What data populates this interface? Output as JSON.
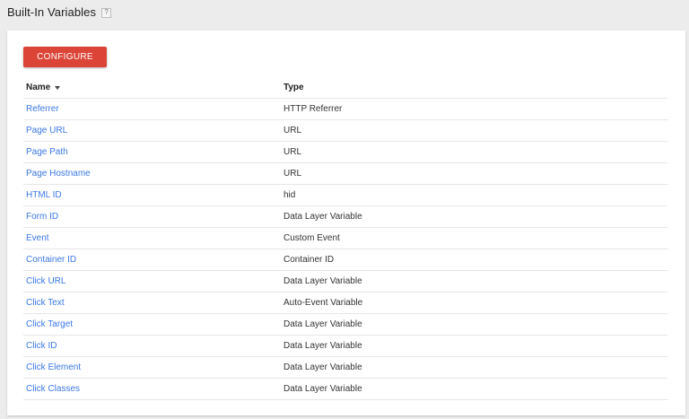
{
  "page": {
    "title": "Built-In Variables",
    "help_glyph": "?"
  },
  "toolbar": {
    "configure_label": "CONFIGURE"
  },
  "table": {
    "columns": {
      "name": "Name",
      "type": "Type"
    },
    "sort": {
      "column": "name",
      "direction": "descending-arrow"
    },
    "rows": [
      {
        "name": "Referrer",
        "type": "HTTP Referrer"
      },
      {
        "name": "Page URL",
        "type": "URL"
      },
      {
        "name": "Page Path",
        "type": "URL"
      },
      {
        "name": "Page Hostname",
        "type": "URL"
      },
      {
        "name": "HTML ID",
        "type": "hid"
      },
      {
        "name": "Form ID",
        "type": "Data Layer Variable"
      },
      {
        "name": "Event",
        "type": "Custom Event"
      },
      {
        "name": "Container ID",
        "type": "Container ID"
      },
      {
        "name": "Click URL",
        "type": "Data Layer Variable"
      },
      {
        "name": "Click Text",
        "type": "Auto-Event Variable"
      },
      {
        "name": "Click Target",
        "type": "Data Layer Variable"
      },
      {
        "name": "Click ID",
        "type": "Data Layer Variable"
      },
      {
        "name": "Click Element",
        "type": "Data Layer Variable"
      },
      {
        "name": "Click Classes",
        "type": "Data Layer Variable"
      }
    ]
  },
  "colors": {
    "accent_button": "#db4437",
    "link": "#3b78e7",
    "page_background": "#ececec",
    "card_background": "#ffffff"
  },
  "icons": {
    "help": "help-icon",
    "sort": "sort-arrow-icon"
  }
}
